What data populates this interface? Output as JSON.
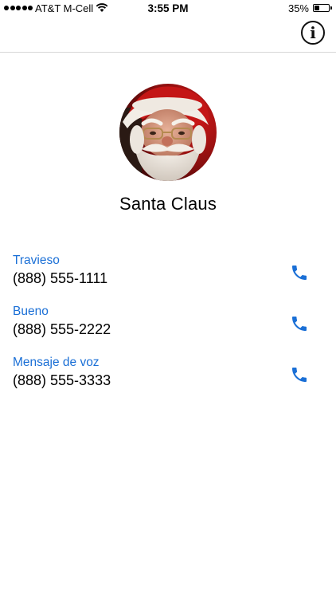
{
  "status_bar": {
    "carrier": "AT&T M-Cell",
    "time": "3:55 PM",
    "battery_percent": "35%",
    "battery_level": 0.35,
    "signal_bars": 5,
    "icons": [
      "signal-dots-icon",
      "wifi-icon",
      "battery-icon"
    ]
  },
  "nav_bar": {
    "info_icon": "info-icon",
    "info_glyph": "i"
  },
  "contact": {
    "name": "Santa Claus",
    "avatar": "santa-claus-photo"
  },
  "phones": [
    {
      "label": "Travieso",
      "number": "(888) 555-1111",
      "icon": "phone-icon"
    },
    {
      "label": "Bueno",
      "number": "(888) 555-2222",
      "icon": "phone-icon"
    },
    {
      "label": "Mensaje de voz",
      "number": "(888) 555-3333",
      "icon": "phone-icon"
    }
  ],
  "colors": {
    "accent": "#1a6fd6",
    "text": "#000000",
    "divider": "#d6d6d6",
    "background": "#ffffff"
  }
}
